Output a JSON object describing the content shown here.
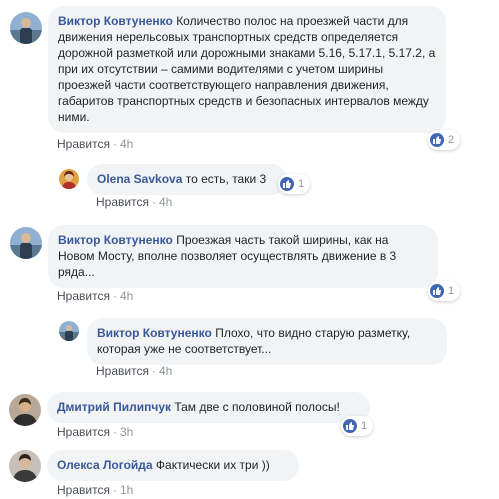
{
  "comments": [
    {
      "author": "Виктор Ковтуненко",
      "text": "Количество полос на проезжей части для движения нерельсовых транспортных средств определяется дорожной разметкой или дорожными знаками 5.16, 5.17.1, 5.17.2, а при их отсутствии – самими водителями с учетом ширины проезжей части соответствующего направления движения, габаритов транспортных средств и безопасных интервалов между ними.",
      "like_label": "Нравится",
      "time": "4h",
      "reactions": "2",
      "avatar_colors": [
        "#6b8fb5",
        "#3b4d5e"
      ]
    },
    {
      "author": "Olena Savkova",
      "text": "то есть, таки 3",
      "like_label": "Нравится",
      "time": "4h",
      "reactions": "1",
      "avatar_colors": [
        "#c0392b",
        "#e8b04a"
      ]
    },
    {
      "author": "Виктор Ковтуненко",
      "text": "Проезжая часть такой ширины, как на Новом Мосту, вполне позволяет осуществлять движение в 3 ряда...",
      "like_label": "Нравится",
      "time": "4h",
      "reactions": "1",
      "avatar_colors": [
        "#6b8fb5",
        "#3b4d5e"
      ]
    },
    {
      "author": "Виктор Ковтуненко",
      "text": "Плохо, что видно старую разметку, которая уже не соответствует...",
      "like_label": "Нравится",
      "time": "4h",
      "reactions": "",
      "avatar_colors": [
        "#6b8fb5",
        "#3b4d5e"
      ]
    },
    {
      "author": "Дмитрий Пилипчук",
      "text": "Там две с половиной полосы!",
      "like_label": "Нравится",
      "time": "3h",
      "reactions": "1",
      "avatar_colors": [
        "#7a6a5a",
        "#2d2d2d"
      ]
    },
    {
      "author": "Олекса Логойда",
      "text": "Фактически их три ))",
      "like_label": "Нравится",
      "time": "1h",
      "reactions": "",
      "avatar_colors": [
        "#9a8a7a",
        "#3a3a3a"
      ]
    }
  ],
  "colors": {
    "author": "#385898",
    "bubble": "#f2f3f5",
    "meta": "#90949c",
    "like_icon": "#4267b2"
  },
  "icons": {
    "reaction": "thumbs-up-icon"
  }
}
